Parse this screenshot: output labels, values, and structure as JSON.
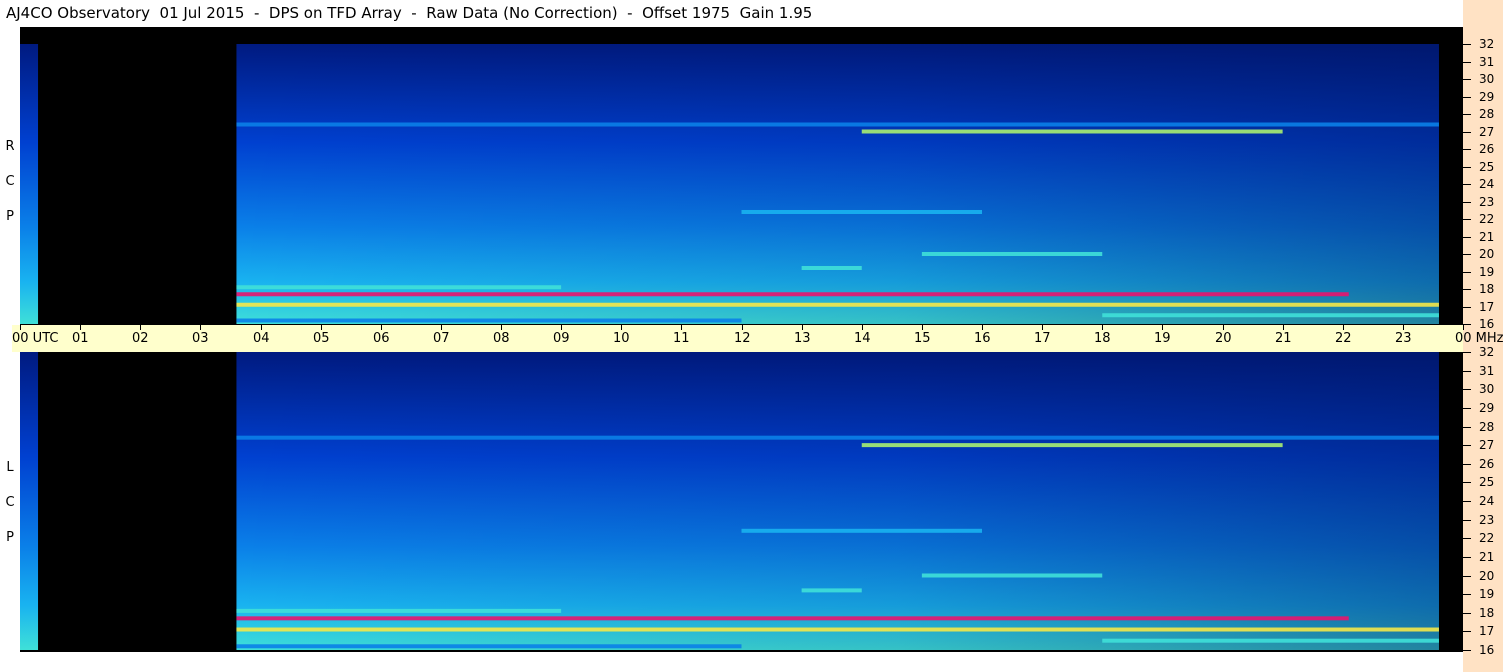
{
  "title": "AJ4CO Observatory  01 Jul 2015  -  DPS on TFD Array  -  Raw Data (No Correction)  -  Offset 1975  Gain 1.95",
  "chart_data": {
    "type": "heatmap",
    "title": "AJ4CO Observatory  01 Jul 2015  -  DPS on TFD Array  -  Raw Data (No Correction)  -  Offset 1975  Gain 1.95",
    "x_axis": {
      "label": "UTC",
      "range": [
        0,
        24
      ],
      "ticks": [
        "00",
        "01",
        "02",
        "03",
        "04",
        "05",
        "06",
        "07",
        "08",
        "09",
        "10",
        "11",
        "12",
        "13",
        "14",
        "15",
        "16",
        "17",
        "18",
        "19",
        "20",
        "21",
        "22",
        "23",
        "00"
      ]
    },
    "y_axis": {
      "unit": "MHz",
      "range": [
        16,
        32
      ],
      "ticks": [
        "32",
        "31",
        "30",
        "29",
        "28",
        "27",
        "26",
        "25",
        "24",
        "23",
        "22",
        "21",
        "20",
        "19",
        "18",
        "17",
        "16"
      ]
    },
    "panels": [
      {
        "name": "R C P",
        "letters": [
          "R",
          "C",
          "P"
        ]
      },
      {
        "name": "L C P",
        "letters": [
          "L",
          "C",
          "P"
        ]
      }
    ],
    "no_data_utc": [
      0.3,
      3.6
    ],
    "data_end_utc": 23.6,
    "bands": [
      {
        "start": 3.6,
        "end": 23.6,
        "mhz": 17.1,
        "level": 0.8
      },
      {
        "start": 3.6,
        "end": 22.1,
        "mhz": 17.7,
        "level": 0.95
      },
      {
        "start": 3.6,
        "end": 9.0,
        "mhz": 18.1,
        "level": 0.6
      },
      {
        "start": 14.0,
        "end": 21.0,
        "mhz": 27.0,
        "level": 0.65
      },
      {
        "start": 3.6,
        "end": 23.6,
        "mhz": 27.4,
        "level": 0.35
      },
      {
        "start": 12.0,
        "end": 16.0,
        "mhz": 22.4,
        "level": 0.45
      },
      {
        "start": 15.0,
        "end": 18.0,
        "mhz": 20.0,
        "level": 0.5
      },
      {
        "start": 13.0,
        "end": 14.0,
        "mhz": 19.2,
        "level": 0.55
      },
      {
        "start": 18.0,
        "end": 23.6,
        "mhz": 16.5,
        "level": 0.6
      },
      {
        "start": 3.6,
        "end": 12.0,
        "mhz": 16.2,
        "level": 0.35
      }
    ],
    "colormap": [
      "#000000",
      "#001a80",
      "#0040d0",
      "#0a7fe8",
      "#19b3f0",
      "#3fe0d8",
      "#a8f070",
      "#f5e848",
      "#ff7a2a",
      "#e8146e"
    ]
  }
}
